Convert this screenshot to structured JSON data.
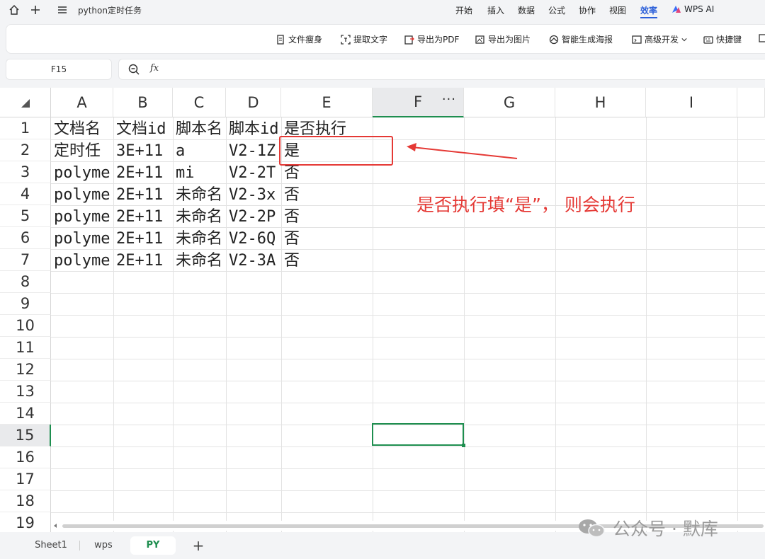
{
  "topbar": {
    "title": "python定时任务",
    "menus": [
      "开始",
      "插入",
      "数据",
      "公式",
      "协作",
      "视图",
      "效率"
    ],
    "ai_label": "WPS AI"
  },
  "toolbar": {
    "tools": [
      "文件瘦身",
      "提取文字",
      "导出为PDF",
      "导出为图片",
      "智能生成海报",
      "高级开发",
      "快捷键"
    ]
  },
  "formula_bar": {
    "cell_ref": "F15",
    "fx": "fx",
    "content": ""
  },
  "grid": {
    "columns": [
      "A",
      "B",
      "C",
      "D",
      "E",
      "F",
      "G",
      "H",
      "I"
    ],
    "rows": [
      "1",
      "2",
      "3",
      "4",
      "5",
      "6",
      "7",
      "8",
      "9",
      "10",
      "11",
      "12",
      "13",
      "14",
      "15",
      "16",
      "17",
      "18",
      "19"
    ],
    "col_menu": "···",
    "cells": [
      [
        "文档名",
        "文档id",
        "脚本名",
        "脚本id",
        "是否执行"
      ],
      [
        "定时任",
        "3E+11",
        "a",
        "V2-1Z",
        "是"
      ],
      [
        "polyme",
        "2E+11",
        "mi",
        "V2-2T",
        "否"
      ],
      [
        "polyme",
        "2E+11",
        "未命名",
        "V2-3x",
        "否"
      ],
      [
        "polyme",
        "2E+11",
        "未命名",
        "V2-2P",
        "否"
      ],
      [
        "polyme",
        "2E+11",
        "未命名",
        "V2-6Q",
        "否"
      ],
      [
        "polyme",
        "2E+11",
        "未命名",
        "V2-3A",
        "否"
      ]
    ]
  },
  "annotation": {
    "text": "是否执行填“是”， 则会执行",
    "color": "#e53935"
  },
  "sheet_tabs": {
    "tabs": [
      "Sheet1",
      "wps",
      "PY"
    ],
    "active": "PY",
    "add": "+"
  },
  "watermark": {
    "text": "公众号 · 默库"
  },
  "colors": {
    "accent": "#1e8e4f",
    "menu_active": "#2b5fd9"
  }
}
